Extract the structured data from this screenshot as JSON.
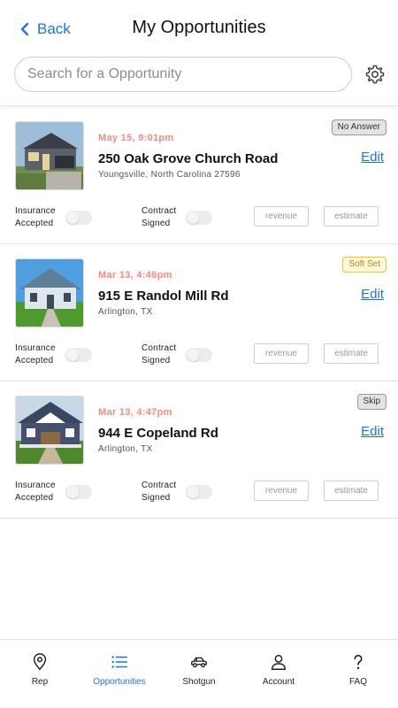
{
  "header": {
    "back_label": "Back",
    "title": "My Opportunities",
    "search_placeholder": "Search for a Opportunity"
  },
  "labels": {
    "insurance_line1": "Insurance",
    "insurance_line2": "Accepted",
    "contract_line1": "Contract",
    "contract_line2": "Signed",
    "revenue_placeholder": "revenue",
    "estimate_placeholder": "estimate",
    "edit": "Edit"
  },
  "opportunities": [
    {
      "date": "May 15, 9:01pm",
      "address": "250 Oak Grove Church Road",
      "city": "Youngsville, North Carolina 27596",
      "status": "No Answer",
      "insurance_accepted": false,
      "contract_signed": false
    },
    {
      "date": "Mar 13, 4:46pm",
      "address": "915 E Randol Mill Rd",
      "city": "Arlington, TX",
      "status": "Soft Set",
      "insurance_accepted": false,
      "contract_signed": false
    },
    {
      "date": "Mar 13, 4:47pm",
      "address": "944 E Copeland Rd",
      "city": "Arlington, TX",
      "status": "Skip",
      "insurance_accepted": false,
      "contract_signed": false
    }
  ],
  "tabs": [
    {
      "label": "Rep",
      "icon": "map-pin-icon",
      "active": false
    },
    {
      "label": "Opportunities",
      "icon": "list-icon",
      "active": true
    },
    {
      "label": "Shotgun",
      "icon": "car-icon",
      "active": false
    },
    {
      "label": "Account",
      "icon": "user-icon",
      "active": false
    },
    {
      "label": "FAQ",
      "icon": "question-icon",
      "active": false
    }
  ],
  "colors": {
    "accent": "#1a73e8",
    "date": "#f28b82",
    "soft_set_badge": "#f5c518"
  }
}
